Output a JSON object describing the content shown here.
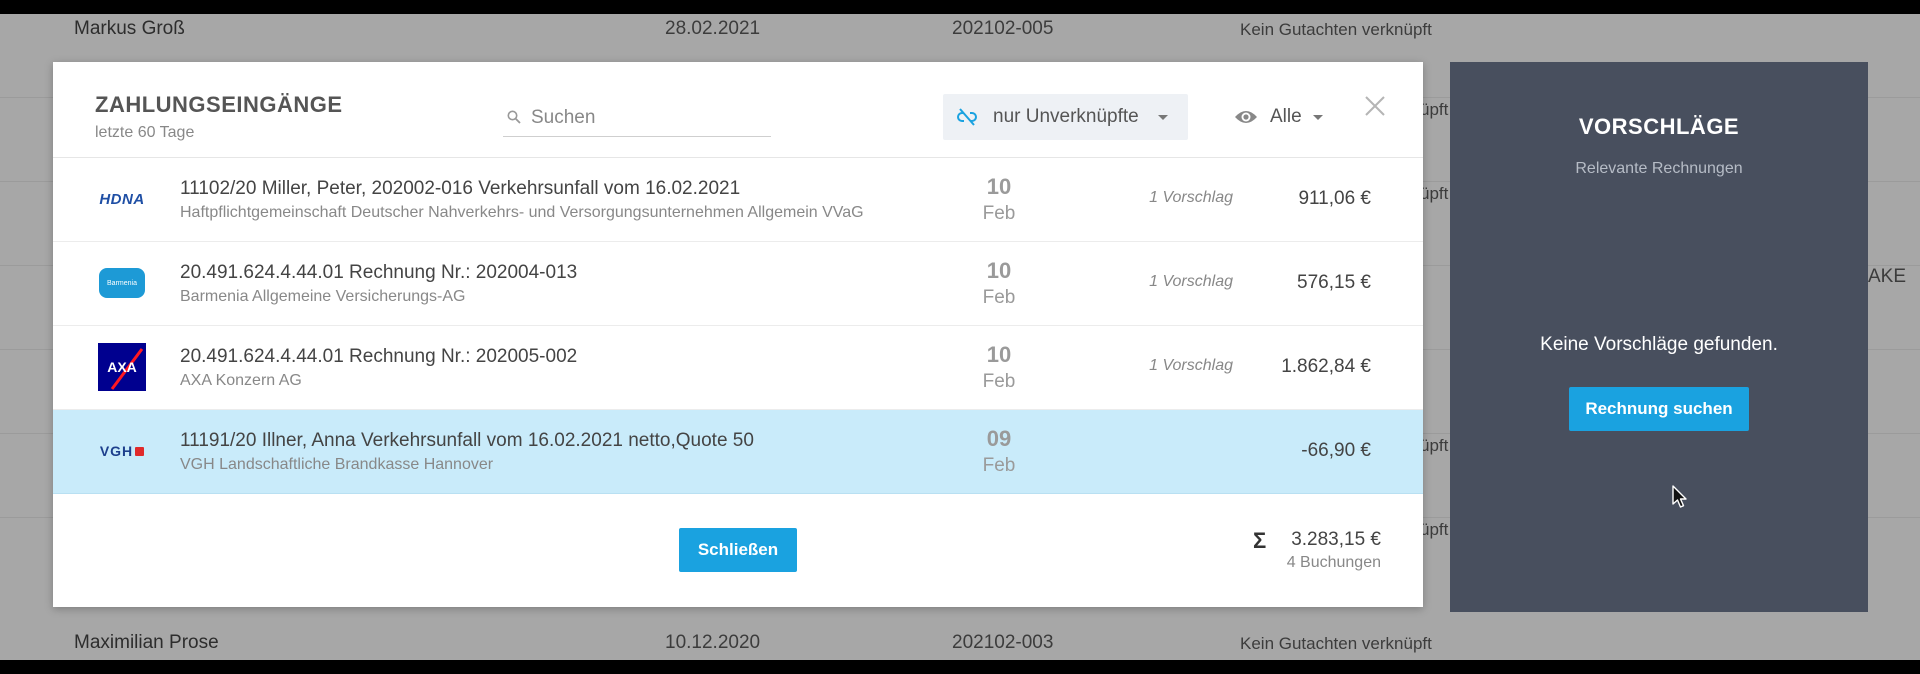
{
  "background": {
    "rows": [
      {
        "name": "Markus Groß",
        "date": "28.02.2021",
        "number": "202102-005",
        "status": "Kein Gutachten verknüpft"
      },
      {
        "name": "Maximilian Prose",
        "date": "10.12.2020",
        "number": "202102-003",
        "status": "Kein Gutachten verknüpft"
      }
    ],
    "fragments": [
      "üpft",
      "üpft",
      "AKE",
      "üpft",
      "üpft"
    ]
  },
  "modal": {
    "title": "ZAHLUNGSEINGÄNGE",
    "subtitle": "letzte 60 Tage",
    "search_placeholder": "Suchen",
    "filter_link_label": "nur Unverknüpfte",
    "filter_visibility_label": "Alle",
    "close_button_label": "Schließen",
    "sum_amount": "3.283,15 €",
    "sum_count": "4 Buchungen",
    "payments": [
      {
        "logo": "HDNA",
        "title": "11102/20 Miller, Peter,  202002-016  Verkehrsunfall vom 16.02.2021",
        "payer": "Haftpflichtgemeinschaft Deutscher Nahverkehrs- und Versorgungsunternehmen Allgemein VVaG",
        "day": "10",
        "month": "Feb",
        "suggestions": "1 Vorschlag",
        "amount": "911,06 €"
      },
      {
        "logo": "Barmenia",
        "title": "20.491.624.4.44.01 Rechnung Nr.:  202004-013",
        "payer": "Barmenia Allgemeine Versicherungs-AG",
        "day": "10",
        "month": "Feb",
        "suggestions": "1 Vorschlag",
        "amount": "576,15 €"
      },
      {
        "logo": "AXA",
        "title": "20.491.624.4.44.01 Rechnung Nr.:  202005-002",
        "payer": "AXA Konzern AG",
        "day": "10",
        "month": "Feb",
        "suggestions": "1 Vorschlag",
        "amount": "1.862,84 €"
      },
      {
        "logo": "VGH",
        "title": "11191/20 Illner, Anna Verkehrsunfall vom 16.02.2021 netto,Quote 50",
        "payer": "VGH Landschaftliche Brandkasse Hannover",
        "day": "09",
        "month": "Feb",
        "suggestions": "",
        "amount": "-66,90 €",
        "selected": true
      }
    ]
  },
  "panel": {
    "title": "VORSCHLÄGE",
    "subtitle": "Relevante Rechnungen",
    "empty_text": "Keine Vorschläge gefunden.",
    "search_button_label": "Rechnung suchen"
  },
  "colors": {
    "accent": "#1aa2e0",
    "selected_row": "#c9ebfa",
    "panel_bg": "#484f5e",
    "hdna_blue": "#1f4fa5",
    "barmenia_blue": "#1d9ad6",
    "axa_blue": "#00008f",
    "axa_red": "#ff1721",
    "vgh_blue": "#1d3f8c"
  }
}
